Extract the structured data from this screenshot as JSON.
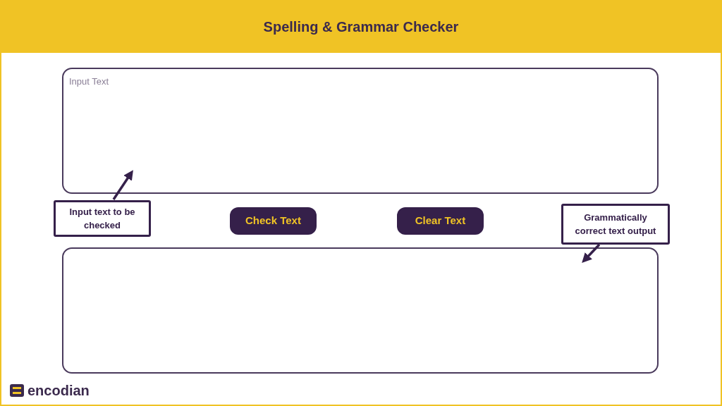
{
  "header": {
    "title": "Spelling & Grammar Checker"
  },
  "input_box": {
    "placeholder": "Input Text"
  },
  "buttons": [
    {
      "label": "Check Text"
    },
    {
      "label": "Clear Text"
    }
  ],
  "annotations": [
    {
      "text": "Input text to be checked"
    },
    {
      "text": "Grammatically correct text output"
    }
  ],
  "logo": {
    "text": "encodian"
  }
}
